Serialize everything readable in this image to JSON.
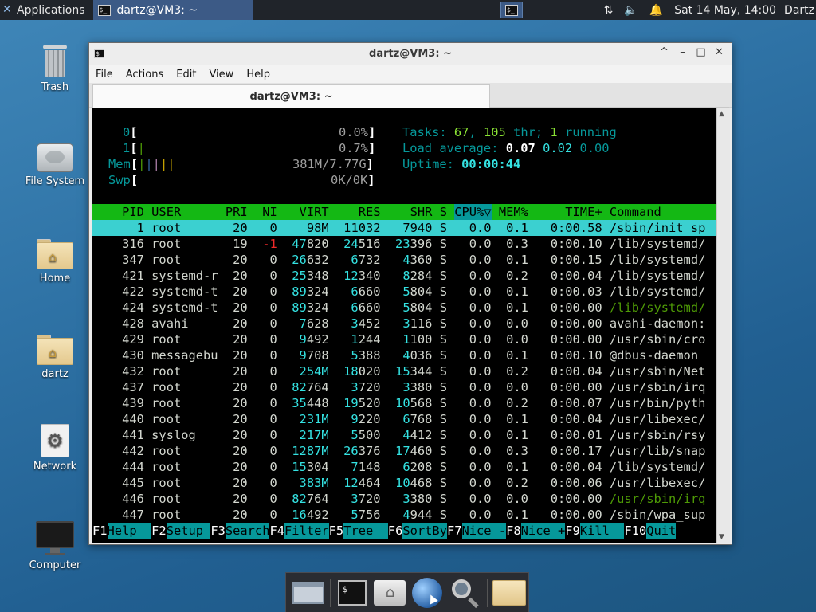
{
  "top_panel": {
    "applications_label": "Applications",
    "task_title": "dartz@VM3: ~",
    "clock": "Sat 14 May, 14:00",
    "user": "Dartz"
  },
  "desktop_icons": [
    {
      "label": "Trash"
    },
    {
      "label": "File System"
    },
    {
      "label": "Home"
    },
    {
      "label": "dartz"
    },
    {
      "label": "Network"
    },
    {
      "label": "Computer"
    }
  ],
  "window": {
    "title": "dartz@VM3: ~",
    "menu": [
      "File",
      "Actions",
      "Edit",
      "View",
      "Help"
    ],
    "tab_title": "dartz@VM3: ~"
  },
  "htop": {
    "cpu0": {
      "label": "0",
      "value": "0.0%"
    },
    "cpu1": {
      "label": "1",
      "value": "0.7%"
    },
    "mem": {
      "label": "Mem",
      "value": "381M/7.77G"
    },
    "swp": {
      "label": "Swp",
      "value": "0K/0K"
    },
    "tasks_label": "Tasks: ",
    "tasks": "67",
    "thr": "105",
    "thr_label": " thr; ",
    "running": "1",
    "running_label": " running",
    "load_label": "Load average: ",
    "load1": "0.07",
    "load5": "0.02",
    "load15": "0.00",
    "uptime_label": "Uptime: ",
    "uptime": "00:00:44",
    "columns": [
      "PID",
      "USER",
      "PRI",
      "NI",
      "VIRT",
      "RES",
      "SHR",
      "S",
      "CPU%▽",
      "MEM%",
      "TIME+",
      "Command"
    ],
    "processes": [
      {
        "pid": "1",
        "user": "root",
        "pri": "20",
        "ni": "0",
        "virt": "98M",
        "res": "11032",
        "shr": "7940",
        "s": "S",
        "cpu": "0.0",
        "mem": "0.1",
        "time": "0:00.58",
        "cmd": "/sbin/init sp"
      },
      {
        "pid": "316",
        "user": "root",
        "pri": "19",
        "ni": "-1",
        "virt": "47820",
        "res": "24516",
        "shr": "23396",
        "s": "S",
        "cpu": "0.0",
        "mem": "0.3",
        "time": "0:00.10",
        "cmd": "/lib/systemd/"
      },
      {
        "pid": "347",
        "user": "root",
        "pri": "20",
        "ni": "0",
        "virt": "26632",
        "res": "6732",
        "shr": "4360",
        "s": "S",
        "cpu": "0.0",
        "mem": "0.1",
        "time": "0:00.15",
        "cmd": "/lib/systemd/"
      },
      {
        "pid": "421",
        "user": "systemd-r",
        "pri": "20",
        "ni": "0",
        "virt": "25348",
        "res": "12340",
        "shr": "8284",
        "s": "S",
        "cpu": "0.0",
        "mem": "0.2",
        "time": "0:00.04",
        "cmd": "/lib/systemd/"
      },
      {
        "pid": "422",
        "user": "systemd-t",
        "pri": "20",
        "ni": "0",
        "virt": "89324",
        "res": "6660",
        "shr": "5804",
        "s": "S",
        "cpu": "0.0",
        "mem": "0.1",
        "time": "0:00.03",
        "cmd": "/lib/systemd/"
      },
      {
        "pid": "424",
        "user": "systemd-t",
        "pri": "20",
        "ni": "0",
        "virt": "89324",
        "res": "6660",
        "shr": "5804",
        "s": "S",
        "cpu": "0.0",
        "mem": "0.1",
        "time": "0:00.00",
        "cmd": "/lib/systemd/"
      },
      {
        "pid": "428",
        "user": "avahi",
        "pri": "20",
        "ni": "0",
        "virt": "7628",
        "res": "3452",
        "shr": "3116",
        "s": "S",
        "cpu": "0.0",
        "mem": "0.0",
        "time": "0:00.00",
        "cmd": "avahi-daemon:"
      },
      {
        "pid": "429",
        "user": "root",
        "pri": "20",
        "ni": "0",
        "virt": "9492",
        "res": "1244",
        "shr": "1100",
        "s": "S",
        "cpu": "0.0",
        "mem": "0.0",
        "time": "0:00.00",
        "cmd": "/usr/sbin/cro"
      },
      {
        "pid": "430",
        "user": "messagebu",
        "pri": "20",
        "ni": "0",
        "virt": "9708",
        "res": "5388",
        "shr": "4036",
        "s": "S",
        "cpu": "0.0",
        "mem": "0.1",
        "time": "0:00.10",
        "cmd": "@dbus-daemon"
      },
      {
        "pid": "432",
        "user": "root",
        "pri": "20",
        "ni": "0",
        "virt": "254M",
        "res": "18020",
        "shr": "15344",
        "s": "S",
        "cpu": "0.0",
        "mem": "0.2",
        "time": "0:00.04",
        "cmd": "/usr/sbin/Net"
      },
      {
        "pid": "437",
        "user": "root",
        "pri": "20",
        "ni": "0",
        "virt": "82764",
        "res": "3720",
        "shr": "3380",
        "s": "S",
        "cpu": "0.0",
        "mem": "0.0",
        "time": "0:00.00",
        "cmd": "/usr/sbin/irq"
      },
      {
        "pid": "439",
        "user": "root",
        "pri": "20",
        "ni": "0",
        "virt": "35448",
        "res": "19520",
        "shr": "10568",
        "s": "S",
        "cpu": "0.0",
        "mem": "0.2",
        "time": "0:00.07",
        "cmd": "/usr/bin/pyth"
      },
      {
        "pid": "440",
        "user": "root",
        "pri": "20",
        "ni": "0",
        "virt": "231M",
        "res": "9220",
        "shr": "6768",
        "s": "S",
        "cpu": "0.0",
        "mem": "0.1",
        "time": "0:00.04",
        "cmd": "/usr/libexec/"
      },
      {
        "pid": "441",
        "user": "syslog",
        "pri": "20",
        "ni": "0",
        "virt": "217M",
        "res": "5500",
        "shr": "4412",
        "s": "S",
        "cpu": "0.0",
        "mem": "0.1",
        "time": "0:00.01",
        "cmd": "/usr/sbin/rsy"
      },
      {
        "pid": "442",
        "user": "root",
        "pri": "20",
        "ni": "0",
        "virt": "1287M",
        "res": "26376",
        "shr": "17460",
        "s": "S",
        "cpu": "0.0",
        "mem": "0.3",
        "time": "0:00.17",
        "cmd": "/usr/lib/snap"
      },
      {
        "pid": "444",
        "user": "root",
        "pri": "20",
        "ni": "0",
        "virt": "15304",
        "res": "7148",
        "shr": "6208",
        "s": "S",
        "cpu": "0.0",
        "mem": "0.1",
        "time": "0:00.04",
        "cmd": "/lib/systemd/"
      },
      {
        "pid": "445",
        "user": "root",
        "pri": "20",
        "ni": "0",
        "virt": "383M",
        "res": "12464",
        "shr": "10468",
        "s": "S",
        "cpu": "0.0",
        "mem": "0.2",
        "time": "0:00.06",
        "cmd": "/usr/libexec/"
      },
      {
        "pid": "446",
        "user": "root",
        "pri": "20",
        "ni": "0",
        "virt": "82764",
        "res": "3720",
        "shr": "3380",
        "s": "S",
        "cpu": "0.0",
        "mem": "0.0",
        "time": "0:00.00",
        "cmd": "/usr/sbin/irq"
      },
      {
        "pid": "447",
        "user": "root",
        "pri": "20",
        "ni": "0",
        "virt": "16492",
        "res": "5756",
        "shr": "4944",
        "s": "S",
        "cpu": "0.0",
        "mem": "0.1",
        "time": "0:00.00",
        "cmd": "/sbin/wpa_sup"
      }
    ],
    "fkeys": [
      {
        "key": "F1",
        "label": "Help  "
      },
      {
        "key": "F2",
        "label": "Setup "
      },
      {
        "key": "F3",
        "label": "Search"
      },
      {
        "key": "F4",
        "label": "Filter"
      },
      {
        "key": "F5",
        "label": "Tree  "
      },
      {
        "key": "F6",
        "label": "SortBy"
      },
      {
        "key": "F7",
        "label": "Nice -"
      },
      {
        "key": "F8",
        "label": "Nice +"
      },
      {
        "key": "F9",
        "label": "Kill  "
      },
      {
        "key": "F10",
        "label": "Quit"
      }
    ]
  },
  "colors": {
    "header_bg": "#14b814",
    "selected_bg": "#3bd0d0",
    "fkey_bg": "#06989a",
    "task_button": "#3c5a86"
  }
}
